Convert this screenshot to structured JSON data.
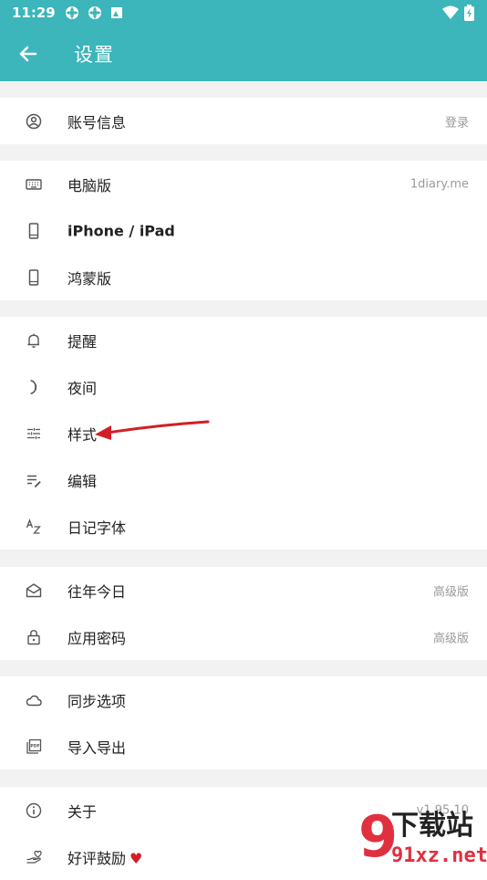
{
  "status_bar": {
    "time": "11:29"
  },
  "app_bar": {
    "title": "设置"
  },
  "sections": [
    {
      "rows": [
        {
          "icon": "account-circle-icon",
          "label": "账号信息",
          "trailing": "登录"
        }
      ]
    },
    {
      "rows": [
        {
          "icon": "keyboard-icon",
          "label": "电脑版",
          "trailing": "1diary.me"
        },
        {
          "icon": "phone-icon",
          "label": "iPhone / iPad",
          "trailing": ""
        },
        {
          "icon": "phone-icon",
          "label": "鸿蒙版",
          "trailing": ""
        }
      ]
    },
    {
      "rows": [
        {
          "icon": "bell-icon",
          "label": "提醒",
          "trailing": ""
        },
        {
          "icon": "moon-icon",
          "label": "夜间",
          "trailing": ""
        },
        {
          "icon": "sliders-icon",
          "label": "样式",
          "trailing": ""
        },
        {
          "icon": "edit-list-icon",
          "label": "编辑",
          "trailing": ""
        },
        {
          "icon": "font-az-icon",
          "label": "日记字体",
          "trailing": ""
        }
      ]
    },
    {
      "rows": [
        {
          "icon": "mail-open-icon",
          "label": "往年今日",
          "trailing": "高级版"
        },
        {
          "icon": "lock-icon",
          "label": "应用密码",
          "trailing": "高级版"
        }
      ]
    },
    {
      "rows": [
        {
          "icon": "cloud-icon",
          "label": "同步选项",
          "trailing": ""
        },
        {
          "icon": "pdf-export-icon",
          "label": "导入导出",
          "trailing": ""
        }
      ]
    },
    {
      "rows": [
        {
          "icon": "info-icon",
          "label": "关于",
          "trailing": "v1.95.10"
        },
        {
          "icon": "hand-heart-icon",
          "label": "好评鼓励",
          "trailing": "",
          "heart": "♥"
        }
      ]
    }
  ],
  "colors": {
    "accent": "#3cb5bb",
    "background": "#f2f2f2",
    "arrow": "#d21f27"
  },
  "watermark": {
    "glyph": "9",
    "top": "下载站",
    "bottom": "91xz.net"
  }
}
